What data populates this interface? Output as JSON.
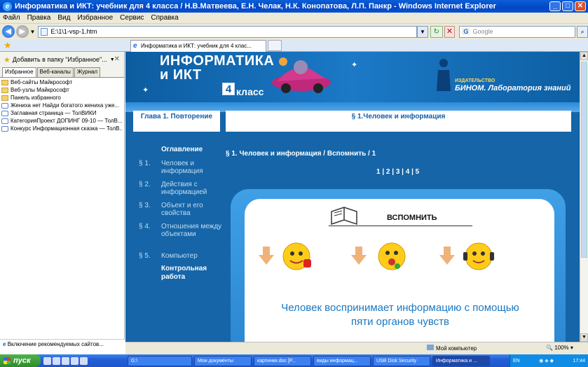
{
  "window": {
    "title": "Информатика и ИКТ: учебник для 4 класса / Н.В.Матвеева, Е.Н. Челак, Н.К. Конопатова, Л.П. Панкр - Windows Internet Explorer"
  },
  "menu": [
    "Файл",
    "Правка",
    "Вид",
    "Избранное",
    "Сервис",
    "Справка"
  ],
  "address": {
    "value": "E:\\1\\1-vsp-1.htm"
  },
  "search": {
    "placeholder": "Google",
    "engine": "G"
  },
  "tab": {
    "label": "Информатика и ИКТ: учебник для 4 клас..."
  },
  "favorites": {
    "add_label": "Добавить в папку \"Избранное\"...",
    "tabs": [
      "Избранное",
      "Веб-каналы",
      "Журнал"
    ],
    "items": [
      {
        "label": "Веб-сайты Майкрософт",
        "type": "folder"
      },
      {
        "label": "Веб-узлы Майкрософт",
        "type": "folder"
      },
      {
        "label": "Панель избранного",
        "type": "folder"
      },
      {
        "label": "Жениха нет   Найди богатого жениха уже...",
        "type": "page"
      },
      {
        "label": "Заглавная страница — ТолВИКИ",
        "type": "page"
      },
      {
        "label": "КатегорияПроект ДОПИНГ 09-10 — ТолВ...",
        "type": "page"
      },
      {
        "label": "Конкурс Информационная сказка — ТолВ...",
        "type": "page"
      }
    ],
    "footer": "Включение рекомендуемых сайтов..."
  },
  "page": {
    "brand_line1": "ИНФОРМАТИКА",
    "brand_line2": "и ИКТ",
    "grade_number": "4",
    "grade_text": "класс",
    "publisher_small": "ИЗДАТЕЛЬСТВО",
    "publisher": "БИНОМ. Лаборатория знаний",
    "chapter": "Глава 1. Повторение",
    "section": "§ 1.Человек и информация",
    "toc_title": "Оглавление",
    "toc": [
      {
        "num": "§ 1.",
        "label": "Человек и информация"
      },
      {
        "num": "§ 2.",
        "label": "Действия с информацией"
      },
      {
        "num": "§ 3.",
        "label": "Объект и его свойства"
      },
      {
        "num": "§ 4.",
        "label": "Отношения между объектами"
      },
      {
        "num": "§ 5.",
        "label": "Компьютер"
      }
    ],
    "toc_final": "Контрольная работа",
    "breadcrumb": "§ 1. Человек и информация / Вспомнить / 1",
    "pages": "1 | 2 | 3 | 4 | 5",
    "heading": "ВСПОМНИТЬ",
    "text": "Человек воспринимает информацию с помощью пяти органов чувств"
  },
  "status": {
    "computer": "Мой компьютер",
    "zoom": "100%"
  },
  "taskbar": {
    "start": "пуск",
    "tasks": [
      {
        "label": "G:\\",
        "width": 92
      },
      {
        "label": "Мои документы",
        "width": 82
      },
      {
        "label": "картинки.doc [Р...",
        "width": 82
      },
      {
        "label": "виды информац...",
        "width": 82
      },
      {
        "label": "USB Disk Security",
        "width": 82
      },
      {
        "label": "Информатика и ...",
        "width": 82
      }
    ],
    "lang": "EN",
    "time": "17:44"
  },
  "colors": {
    "page_bg": "#1565a8",
    "accent": "#1a78c2"
  }
}
